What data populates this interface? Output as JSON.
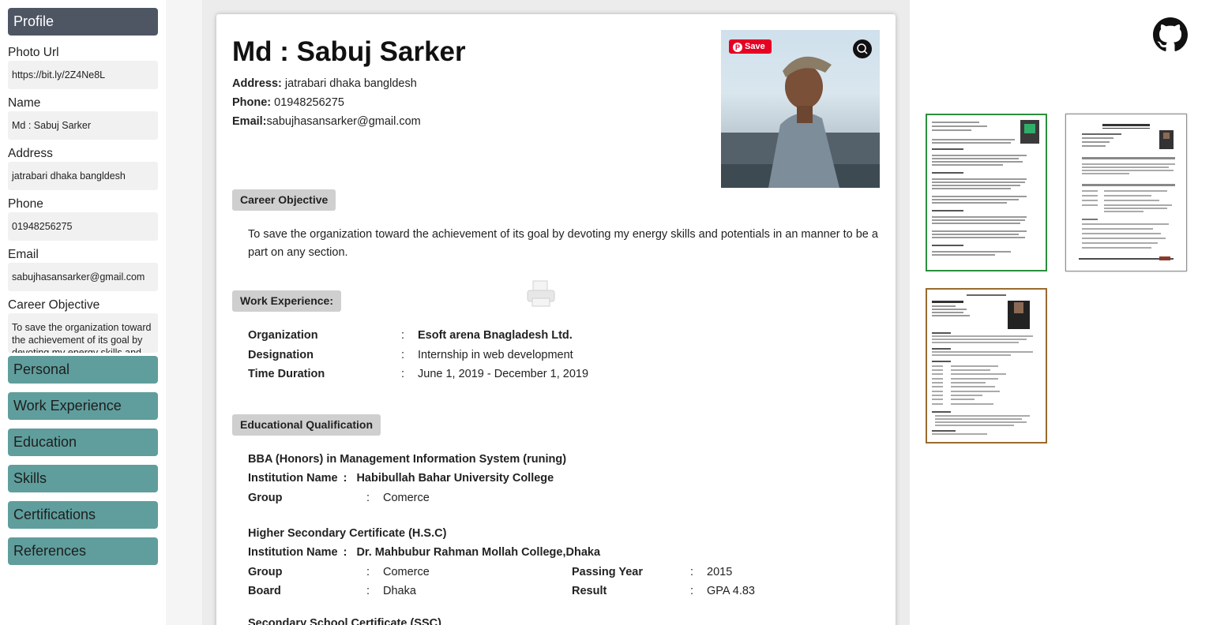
{
  "sidebar": {
    "profile_header": "Profile",
    "fields": {
      "photo_url": {
        "label": "Photo Url",
        "value": "https://bit.ly/2Z4Ne8L"
      },
      "name": {
        "label": "Name",
        "value": "Md : Sabuj Sarker"
      },
      "address": {
        "label": "Address",
        "value": "jatrabari dhaka bangldesh"
      },
      "phone": {
        "label": "Phone",
        "value": "01948256275"
      },
      "email": {
        "label": "Email",
        "value": "sabujhasansarker@gmail.com"
      },
      "career": {
        "label": "Career Objective",
        "value": "To save the organization toward the achievement of its goal by devoting my energy skills and potentials in an manner to be a part on any section."
      }
    },
    "sections": [
      "Personal",
      "Work Experience",
      "Education",
      "Skills",
      "Certifications",
      "References"
    ]
  },
  "resume": {
    "name": "Md : Sabuj Sarker",
    "address_label": "Address:",
    "address": "jatrabari dhaka bangldesh",
    "phone_label": "Phone:",
    "phone": "01948256275",
    "email_label": "Email:",
    "email": "sabujhasansarker@gmail.com",
    "photo_save_label": "Save",
    "career_title": "Career Objective",
    "career_text": "To save the organization toward the achievement of its goal by devoting my energy skills and potentials in an manner to be a part on any section.",
    "work_title": "Work Experience:",
    "work": {
      "org_label": "Organization",
      "org": "Esoft arena Bnagladesh Ltd.",
      "des_label": "Designation",
      "des": "Internship in web development",
      "dur_label": "Time Duration",
      "dur": "June 1, 2019 - December 1, 2019",
      "sep": ":"
    },
    "edu_title": "Educational Qualification",
    "education": [
      {
        "degree": "BBA (Honors) in Management Information System (runing)",
        "inst_label": "Institution Name",
        "inst": "Habibullah Bahar University College",
        "group_label": "Group",
        "group": "Comerce"
      },
      {
        "degree": "Higher Secondary Certificate (H.S.C)",
        "inst_label": "Institution Name",
        "inst": "Dr. Mahbubur Rahman Mollah College,Dhaka",
        "group_label": "Group",
        "group": "Comerce",
        "year_label": "Passing Year",
        "year": "2015",
        "board_label": "Board",
        "board": "Dhaka",
        "result_label": "Result",
        "result": "GPA 4.83"
      },
      {
        "degree": "Secondary School Certificate (SSC)"
      }
    ]
  },
  "colors": {
    "profile_header": "#4e5664",
    "section_header": "#5f9e9d",
    "tag_bg": "#cfcfcf",
    "template_selected": "#2a8f3c",
    "template_brown": "#9a6a2e"
  },
  "icons": {
    "github": "github-icon",
    "print": "print-icon",
    "pinterest": "pinterest-save-icon",
    "lens": "lens-icon"
  }
}
